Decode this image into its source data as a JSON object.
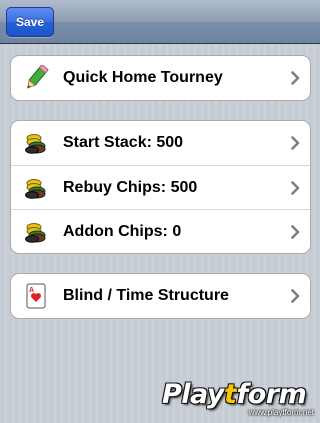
{
  "navbar": {
    "save_label": "Save"
  },
  "groups": [
    {
      "rows": [
        {
          "label": "Quick Home Tourney",
          "icon": "pencil-icon"
        }
      ]
    },
    {
      "rows": [
        {
          "label": "Start Stack: 500",
          "icon": "chips-icon"
        },
        {
          "label": "Rebuy Chips: 500",
          "icon": "chips-icon"
        },
        {
          "label": "Addon Chips: 0",
          "icon": "chips-icon"
        }
      ]
    },
    {
      "rows": [
        {
          "label": "Blind / Time Structure",
          "icon": "playing-card-icon"
        }
      ]
    }
  ],
  "watermark": {
    "logo_pre": "Play",
    "logo_accent": "t",
    "logo_post": "form",
    "url": "www.playtform.net"
  },
  "colors": {
    "accent": "#2461d8",
    "navbar": "#7b8ea8"
  }
}
